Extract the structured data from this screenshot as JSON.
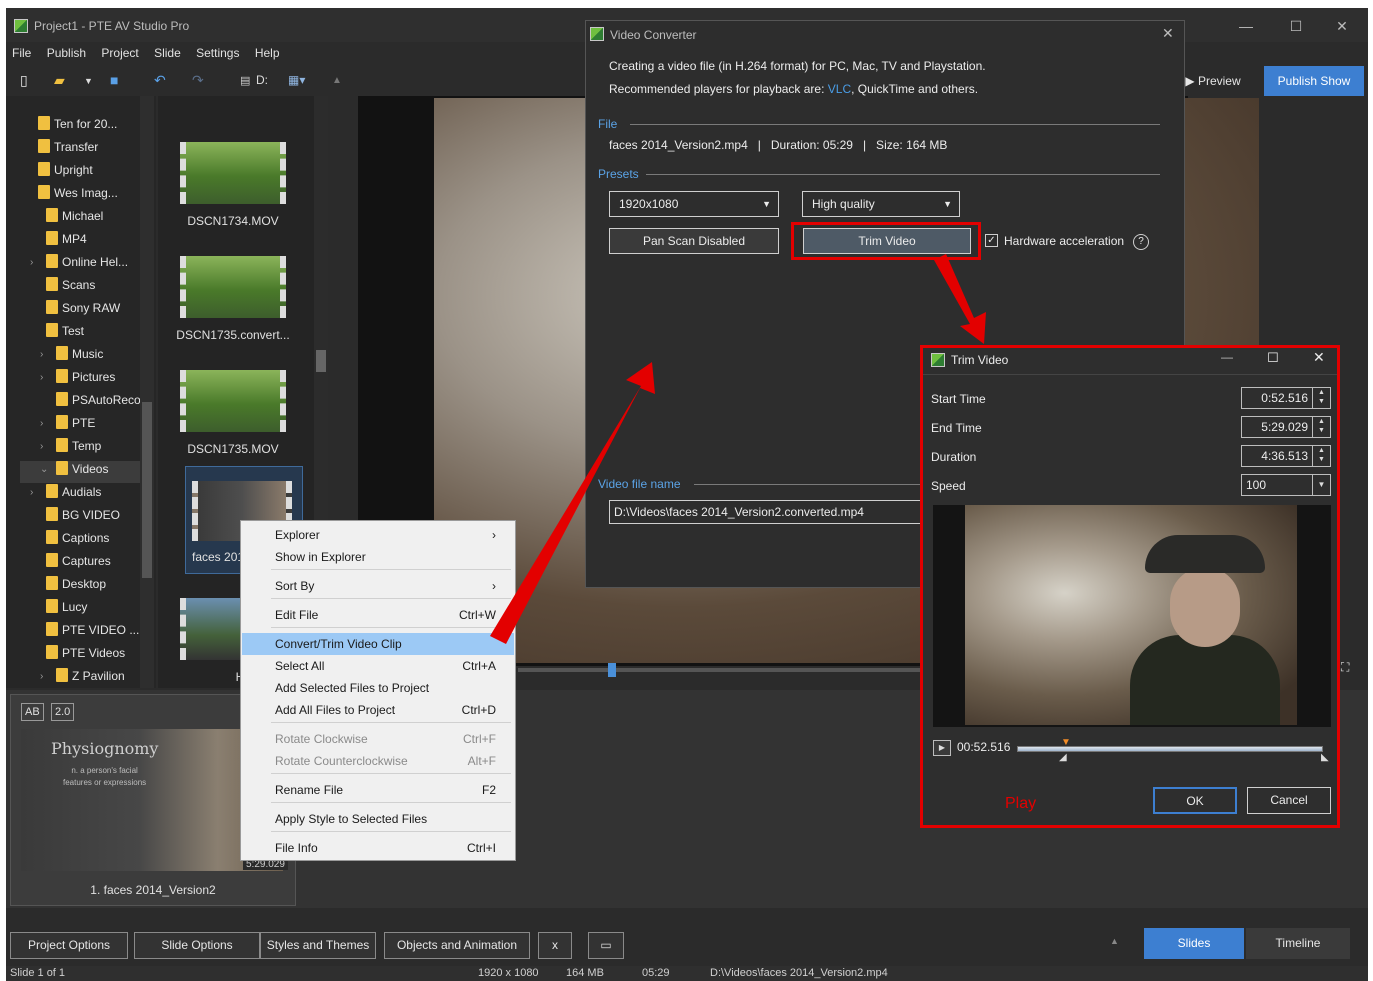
{
  "app": {
    "title": "Project1 - PTE AV Studio Pro",
    "menu": [
      "File",
      "Publish",
      "Project",
      "Slide",
      "Settings",
      "Help"
    ],
    "drive_label": "D:",
    "preview_label": "Preview",
    "publish_label": "Publish Show"
  },
  "tree": {
    "items": [
      {
        "label": "Ten for 20...",
        "indent": 2
      },
      {
        "label": "Transfer",
        "indent": 2
      },
      {
        "label": "Upright",
        "indent": 2
      },
      {
        "label": "Wes Imag...",
        "indent": 2
      },
      {
        "label": "Michael",
        "indent": 1
      },
      {
        "label": "MP4",
        "indent": 1
      },
      {
        "label": "Online Hel...",
        "indent": 1,
        "expand": true
      },
      {
        "label": "Scans",
        "indent": 1
      },
      {
        "label": "Sony RAW",
        "indent": 1
      },
      {
        "label": "Test",
        "indent": 1
      },
      {
        "label": "Music",
        "indent": 0,
        "expand": true
      },
      {
        "label": "Pictures",
        "indent": 0,
        "expand": true
      },
      {
        "label": "PSAutoReco...",
        "indent": 0
      },
      {
        "label": "PTE",
        "indent": 0,
        "expand": true
      },
      {
        "label": "Temp",
        "indent": 0,
        "expand": true
      },
      {
        "label": "Videos",
        "indent": 0,
        "expanded": true,
        "selected": true
      },
      {
        "label": "Audials",
        "indent": 1,
        "expand": true
      },
      {
        "label": "BG VIDEO",
        "indent": 1
      },
      {
        "label": "Captions",
        "indent": 1
      },
      {
        "label": "Captures",
        "indent": 1
      },
      {
        "label": "Desktop",
        "indent": 1
      },
      {
        "label": "Lucy",
        "indent": 1
      },
      {
        "label": "PTE VIDEO ...",
        "indent": 1
      },
      {
        "label": "PTE Videos",
        "indent": 1
      },
      {
        "label": "Z Pavilion",
        "indent": 0,
        "expand": true
      }
    ]
  },
  "thumbs": {
    "items": [
      {
        "label": "DSCN1734.MOV"
      },
      {
        "label": "DSCN1735.convert..."
      },
      {
        "label": "DSCN1735.MOV"
      },
      {
        "label": "faces 201"
      },
      {
        "label": "HROU85"
      }
    ]
  },
  "context_menu": {
    "items": [
      {
        "label": "Explorer",
        "shortcut": "›"
      },
      {
        "label": "Show in Explorer",
        "shortcut": ""
      },
      {
        "label": "Sort By",
        "shortcut": "›"
      },
      {
        "label": "Edit File",
        "shortcut": "Ctrl+W"
      },
      {
        "label": "Convert/Trim Video Clip",
        "shortcut": "",
        "highlighted": true
      },
      {
        "label": "Select All",
        "shortcut": "Ctrl+A"
      },
      {
        "label": "Add Selected Files to Project",
        "shortcut": ""
      },
      {
        "label": "Add All Files to Project",
        "shortcut": "Ctrl+D"
      },
      {
        "label": "Rotate Clockwise",
        "shortcut": "Ctrl+F",
        "disabled": true
      },
      {
        "label": "Rotate Counterclockwise",
        "shortcut": "Alt+F",
        "disabled": true
      },
      {
        "label": "Rename File",
        "shortcut": "F2"
      },
      {
        "label": "Apply Style to Selected Files",
        "shortcut": ""
      },
      {
        "label": "File Info",
        "shortcut": "Ctrl+I"
      }
    ]
  },
  "video_converter": {
    "title": "Video Converter",
    "line1": "Creating a video file (in H.264 format) for PC, Mac, TV and Playstation.",
    "line2_a": "Recommended players for playback are: ",
    "line2_link": "VLC",
    "line2_b": ", QuickTime and others.",
    "file_section": "File",
    "file_info": "faces 2014_Version2.mp4   |   Duration: 05:29   |   Size: 164 MB",
    "presets_section": "Presets",
    "resolution": "1920x1080",
    "quality": "High quality",
    "pan_scan": "Pan Scan Disabled",
    "trim_button": "Trim Video",
    "hw_accel": "Hardware acceleration",
    "hw_checked": "✓",
    "filename_section": "Video file name",
    "filename": "D:\\Videos\\faces 2014_Version2.converted.mp4"
  },
  "trim": {
    "title": "Trim Video",
    "start_label": "Start Time",
    "start_value": "0:52.516",
    "end_label": "End Time",
    "end_value": "5:29.029",
    "duration_label": "Duration",
    "duration_value": "4:36.513",
    "speed_label": "Speed",
    "speed_value": "100",
    "position": "00:52.516",
    "ok": "OK",
    "cancel": "Cancel",
    "annotation": "Play"
  },
  "slide": {
    "badge1": "AB",
    "badge2": "2.0",
    "image_title": "Physiognomy",
    "image_sub": "n. a person's facial\nfeatures or expressions",
    "duration_tag": "5:29.029",
    "caption": "1. faces 2014_Version2"
  },
  "bottom": {
    "project_options": "Project Options",
    "slide_options": "Slide Options",
    "styles_themes": "Styles and Themes",
    "objects_animation": "Objects and Animation",
    "x_label": "x",
    "slides_tab": "Slides",
    "timeline_tab": "Timeline"
  },
  "status": {
    "slide": "Slide 1 of 1",
    "res": "1920 x 1080",
    "size": "164 MB",
    "dur": "05:29",
    "path": "D:\\Videos\\faces 2014_Version2.mp4"
  },
  "colors": {
    "accent": "#3d7fd1",
    "highlight_red": "#e30000",
    "menu_highlight": "#9cc9f5"
  }
}
